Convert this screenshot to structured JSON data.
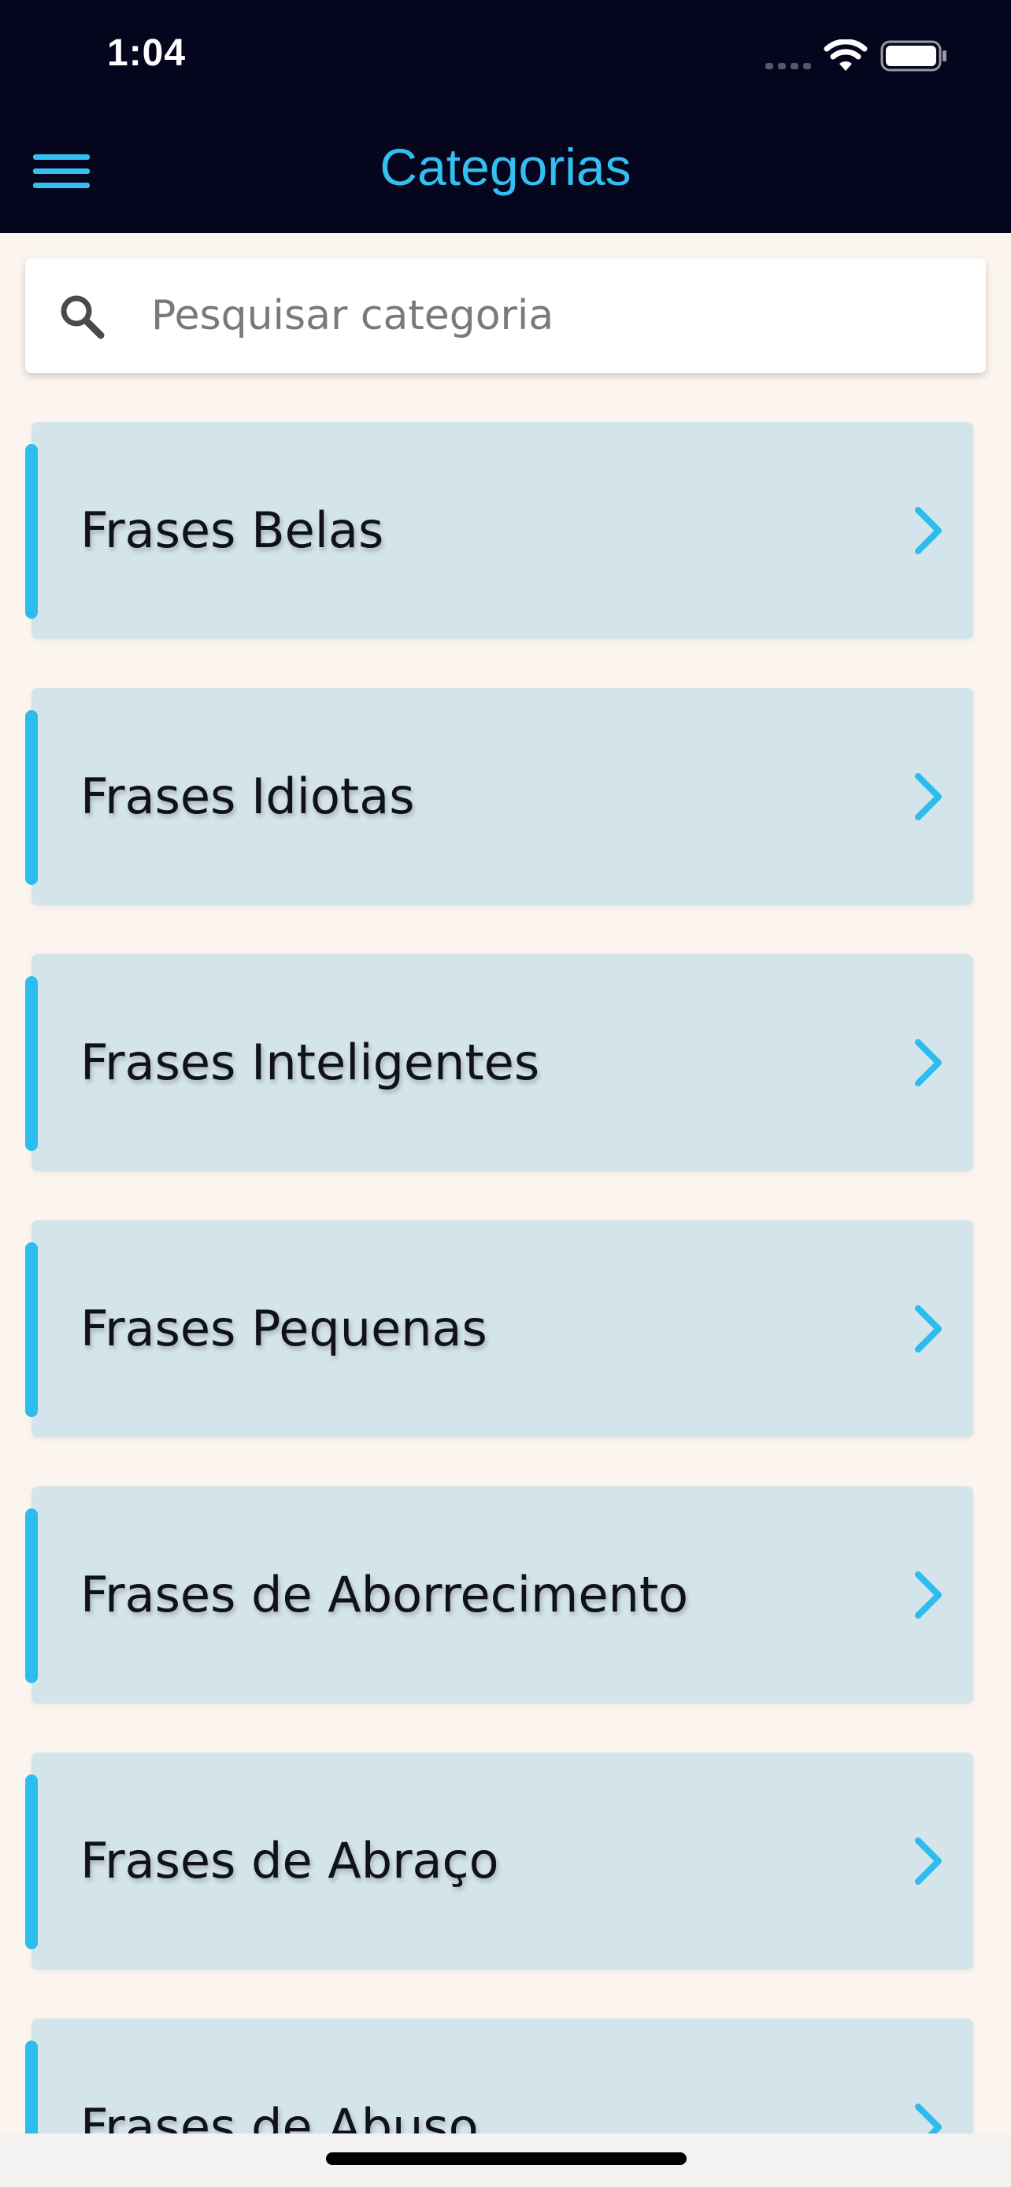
{
  "status_bar": {
    "time": "1:04"
  },
  "nav": {
    "title": "Categorias",
    "menu_icon": "hamburger-menu-icon",
    "accent_color": "#33c0f0"
  },
  "search": {
    "placeholder": "Pesquisar categoria",
    "value": "",
    "icon": "search-icon"
  },
  "categories": [
    {
      "label": "Frases Belas"
    },
    {
      "label": "Frases Idiotas"
    },
    {
      "label": "Frases Inteligentes"
    },
    {
      "label": "Frases Pequenas"
    },
    {
      "label": "Frases de Aborrecimento"
    },
    {
      "label": "Frases de Abraço"
    },
    {
      "label": "Frases de Abuso"
    }
  ],
  "colors": {
    "header_bg": "#05061d",
    "card_bg": "#d3e4ea",
    "accent": "#2dbcee",
    "content_bg": "#fcf5ef"
  }
}
